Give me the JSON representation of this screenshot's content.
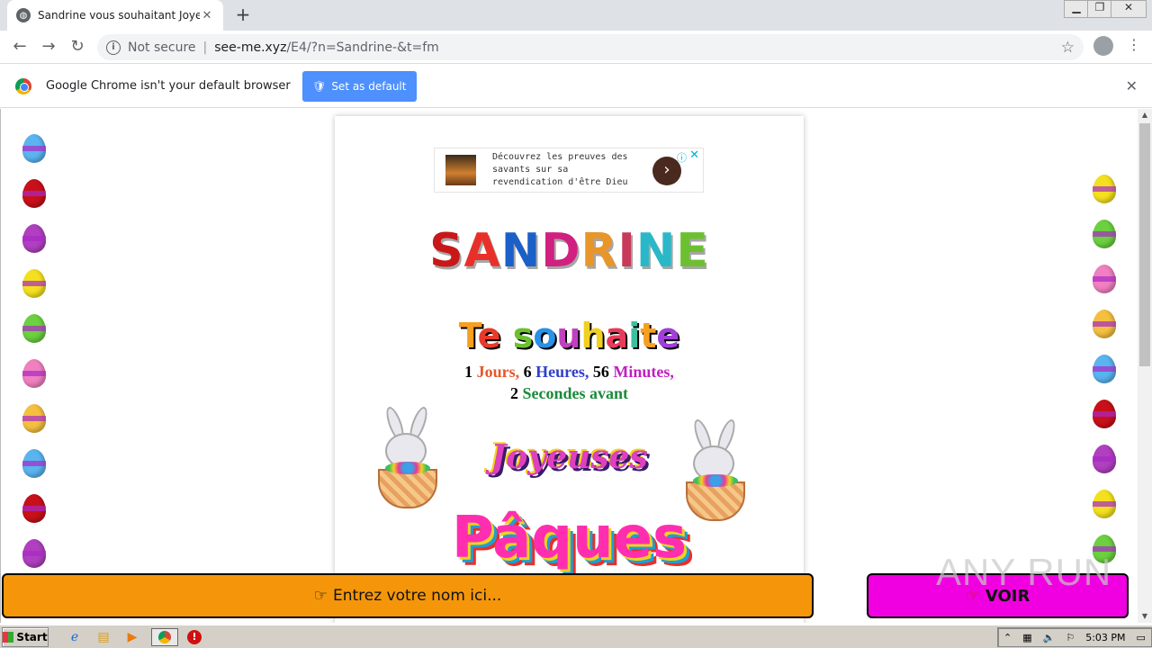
{
  "browser": {
    "tab_title": "Sandrine vous souhaitant Joyeuses",
    "new_tab": "+",
    "security_label": "Not secure",
    "url_host": "see-me.xyz",
    "url_path": "/E4/?n=Sandrine-&t=fm",
    "infobar_text": "Google Chrome isn't your default browser",
    "set_default_label": "Set as default"
  },
  "ad": {
    "text": "Découvrez les preuves des savants sur sa revendication d'être Dieu"
  },
  "greeting": {
    "name": "SANDRINE",
    "souhaite": "Te souhaite",
    "days_value": "1",
    "days_label": "Jours,",
    "hours_value": "6",
    "hours_label": "Heures,",
    "minutes_value": "56",
    "minutes_label": "Minutes,",
    "seconds_value": "2",
    "seconds_label": "Secondes avant",
    "joyeuses": "Joyeuses",
    "paques": "Pâques"
  },
  "actions": {
    "input_label": "Entrez votre nom ici...",
    "voir_label": "VOIR"
  },
  "watermark": "ANY RUN",
  "taskbar": {
    "start_label": "Start",
    "clock": "5:03 PM"
  },
  "colors": {
    "input_bar": "#f5960a",
    "voir_button": "#f000e0",
    "set_default": "#4d90fe"
  }
}
